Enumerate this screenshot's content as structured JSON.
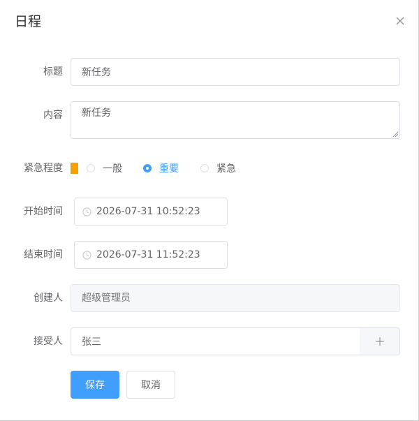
{
  "dialog": {
    "title": "日程",
    "close_icon": "close-icon"
  },
  "form": {
    "title": {
      "label": "标题",
      "value": "新任务"
    },
    "content": {
      "label": "内容",
      "value": "新任务"
    },
    "urgency": {
      "label": "紧急程度",
      "indicator_color": "#f5a200",
      "options": [
        {
          "label": "一般",
          "checked": false
        },
        {
          "label": "重要",
          "checked": true
        },
        {
          "label": "紧急",
          "checked": false
        }
      ]
    },
    "start_time": {
      "label": "开始时间",
      "value": "2026-07-31 10:52:23",
      "icon": "clock-icon"
    },
    "end_time": {
      "label": "结束时间",
      "value": "2026-07-31 11:52:23",
      "icon": "clock-icon"
    },
    "creator": {
      "label": "创建人",
      "placeholder": "超级管理员"
    },
    "assignee": {
      "label": "接受人",
      "value": "张三",
      "add_icon": "plus-icon"
    }
  },
  "actions": {
    "save_label": "保存",
    "cancel_label": "取消"
  },
  "colors": {
    "primary": "#409eff",
    "border": "#dcdfe6",
    "text": "#606266",
    "disabled_bg": "#f5f7fa"
  }
}
